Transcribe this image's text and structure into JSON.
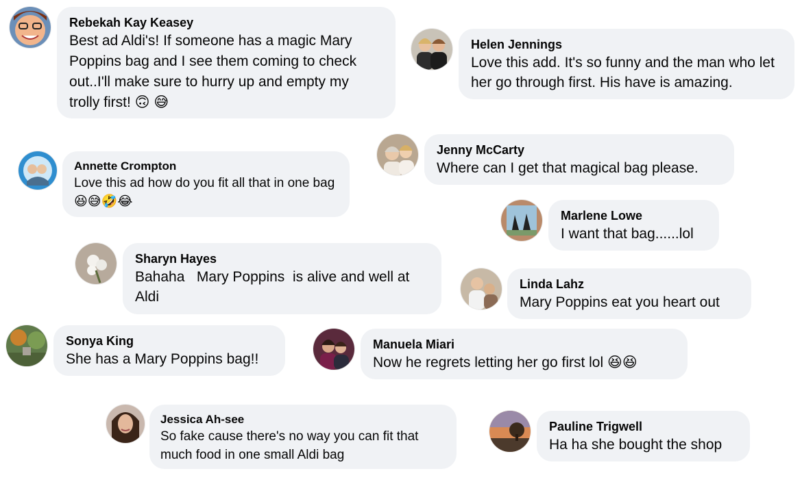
{
  "comments": [
    {
      "author": "Rebekah Kay Keasey",
      "text": "Best ad Aldi's! If someone has a magic Mary Poppins bag and I see them coming to check out..I'll make sure to hurry up and empty my trolly first! 🙃 😅",
      "avatar_icon": "cartoon-face-avatar-icon"
    },
    {
      "author": "Helen Jennings",
      "text": "Love this add. It's so funny and the man who let her go through first. His have is amazing.",
      "avatar_icon": "two-people-photo-avatar-icon"
    },
    {
      "author": "Jenny McCarty",
      "text": "Where can I get that magical bag please.",
      "avatar_icon": "two-people-photo-avatar-icon"
    },
    {
      "author": "Annette Crompton",
      "text": "Love this ad how do you fit all that in one bag 😆😅🤣😂",
      "avatar_icon": "framed-photo-avatar-icon"
    },
    {
      "author": "Marlene Lowe",
      "text": "I want that bag......lol",
      "avatar_icon": "birds-painting-avatar-icon"
    },
    {
      "author": "Sharyn Hayes",
      "text": "Bahaha   Mary Poppins  is alive and well at Aldi",
      "avatar_icon": "flowers-avatar-icon"
    },
    {
      "author": "Linda Lahz",
      "text": "Mary Poppins eat you heart out",
      "avatar_icon": "people-photo-avatar-icon"
    },
    {
      "author": "Sonya King",
      "text": "She has a Mary Poppins bag!!",
      "avatar_icon": "garden-avatar-icon"
    },
    {
      "author": "Manuela Miari",
      "text": "Now he regrets letting her go first lol 😆😆",
      "avatar_icon": "two-people-photo-avatar-icon"
    },
    {
      "author": "Jessica Ah-see",
      "text": "So fake cause there's no way you can fit that much food in one small Aldi bag",
      "avatar_icon": "portrait-avatar-icon"
    },
    {
      "author": "Pauline Trigwell",
      "text": "Ha ha she bought the shop",
      "avatar_icon": "sunset-tree-avatar-icon"
    }
  ],
  "colors": {
    "bubble": "#f0f2f5",
    "text": "#050505"
  }
}
